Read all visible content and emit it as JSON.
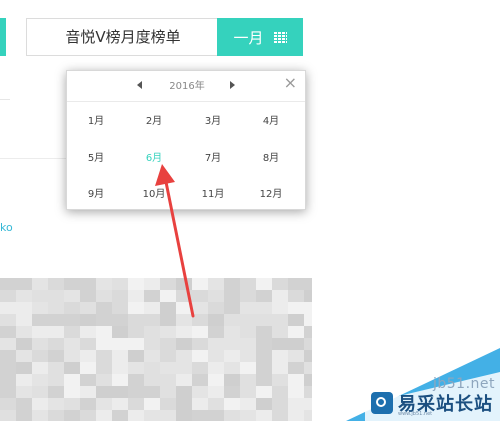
{
  "selector": {
    "title": "音悦V榜月度榜单",
    "button_label": "一月"
  },
  "edge_text": "ko",
  "popup": {
    "year": "2016年",
    "close": "×",
    "months": [
      "1月",
      "2月",
      "3月",
      "4月",
      "5月",
      "6月",
      "7月",
      "8月",
      "9月",
      "10月",
      "11月",
      "12月"
    ],
    "active_month": "6月"
  },
  "watermark": {
    "url": "jb51.net",
    "name": "易采站长站",
    "tagline": "www.jb51.net"
  },
  "colors": {
    "accent": "#35d2bd",
    "annotation_arrow": "#e8413f"
  },
  "icons": {
    "calendar": "calendar-icon",
    "prev": "caret-left-icon",
    "next": "caret-right-icon"
  }
}
